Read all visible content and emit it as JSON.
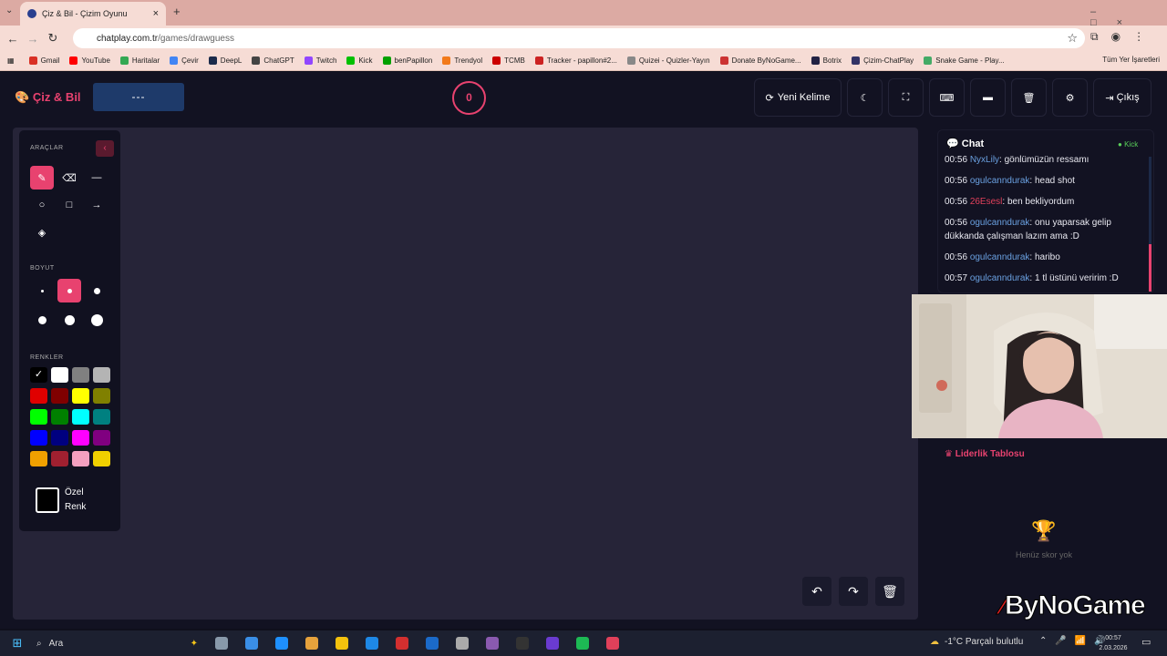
{
  "browser": {
    "tab_title": "Çiz & Bil - Çizim Oyunu",
    "url_host": "chatplay.com.tr",
    "url_path": "/games/drawguess",
    "bookmarks": [
      "Gmail",
      "YouTube",
      "Haritalar",
      "Çevir",
      "DeepL",
      "ChatGPT",
      "Twitch",
      "Kick",
      "benPapillon",
      "Trendyol",
      "TCMB",
      "Tracker - papillon#2...",
      "Quizei - Quizler-Yayın",
      "Donate ByNoGame...",
      "Botrix",
      "Çizim-ChatPlay",
      "Snake Game - Play..."
    ],
    "bookmark_colors": [
      "#d93025",
      "#ff0000",
      "#34a853",
      "#4285f4",
      "#1b2b4b",
      "#444",
      "#9146ff",
      "#00c000",
      "#00a000",
      "#f27a1a",
      "#c00",
      "#c22",
      "#888",
      "#c33",
      "#224",
      "#336",
      "#4a6"
    ],
    "all_bookmarks": "Tüm Yer İşaretleri"
  },
  "header": {
    "logo": "Çiz & Bil",
    "word": "---",
    "timer": "0",
    "new_word": "Yeni Kelime",
    "exit": "Çıkış"
  },
  "tools": {
    "tools_title": "ARAÇLAR",
    "size_title": "BOYUT",
    "colors_title": "RENKLER",
    "custom_color_line1": "Özel",
    "custom_color_line2": "Renk",
    "palette": [
      "#000000",
      "#ffffff",
      "#808080",
      "#b4b4b4",
      "#e00000",
      "#800000",
      "#ffff00",
      "#808000",
      "#00ff00",
      "#008000",
      "#00ffff",
      "#008080",
      "#0000ff",
      "#000080",
      "#ff00ff",
      "#800080",
      "#f0a000",
      "#a02030",
      "#f4a0c0",
      "#f0d000"
    ]
  },
  "chat": {
    "title": "Chat",
    "platform": "Kick",
    "messages": [
      {
        "time": "00:56",
        "user": "NyxLily",
        "text": "gönlümüzün ressamı",
        "color": "#6aa0e0"
      },
      {
        "time": "00:56",
        "user": "ogulcanndurak",
        "text": "head shot",
        "color": "#6aa0e0"
      },
      {
        "time": "00:56",
        "user": "26Esesl",
        "text": "ben bekliyordum",
        "color": "#e0405a"
      },
      {
        "time": "00:56",
        "user": "ogulcanndurak",
        "text": "onu yaparsak gelip dükkanda çalışman lazım ama :D",
        "color": "#6aa0e0"
      },
      {
        "time": "00:56",
        "user": "ogulcanndurak",
        "text": "haribo",
        "color": "#6aa0e0"
      },
      {
        "time": "00:57",
        "user": "ogulcanndurak",
        "text": "1 tl üstünü veririm :D",
        "color": "#6aa0e0"
      }
    ]
  },
  "leaderboard": {
    "title": "Liderlik Tablosu",
    "empty": "Henüz skor yok"
  },
  "watermark": "ByNoGame",
  "taskbar": {
    "search": "Ara",
    "weather": "-1°C  Parçalı bulutlu",
    "time": "00:57",
    "date": "2.03.2026"
  }
}
